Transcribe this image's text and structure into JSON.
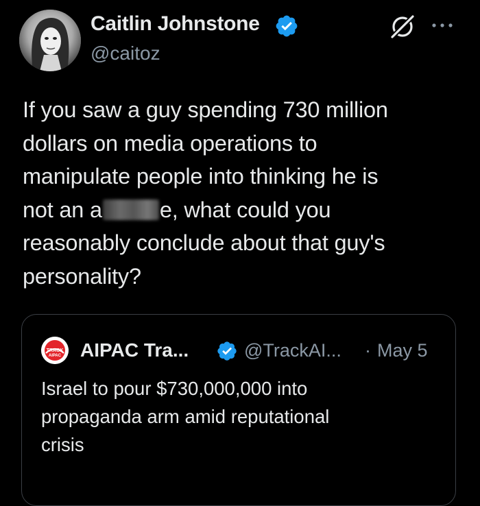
{
  "author": {
    "display_name": "Caitlin Johnstone",
    "handle": "@caitoz",
    "verified": true,
    "verified_color": "#1d9bf0"
  },
  "post": {
    "lines": [
      "If you saw a guy spending 730 million",
      "dollars on media operations to",
      "manipulate people into thinking he is"
    ],
    "line4_before": "not an a",
    "line4_after": "e, what could you",
    "lines_end": [
      "reasonably conclude about that guy's",
      "personality?"
    ]
  },
  "quoted_post": {
    "display_name": "AIPAC Tra...",
    "avatar_text_1": "TRACK",
    "avatar_text_2": "AIPAC",
    "handle": "@TrackAI...",
    "separator": "·",
    "date": "May 5",
    "verified": true,
    "lines": [
      "Israel to pour $730,000,000 into",
      "propaganda arm amid reputational",
      "crisis"
    ]
  },
  "icons": {
    "verified": "verified-badge-icon",
    "grok": "grok-icon",
    "more": "more-options-icon"
  },
  "colors": {
    "background": "#000000",
    "text": "#e7e9ea",
    "secondary_text": "#8b98a5",
    "accent": "#1d9bf0",
    "border": "#3b3f45",
    "aipac_red": "#e3252b"
  }
}
